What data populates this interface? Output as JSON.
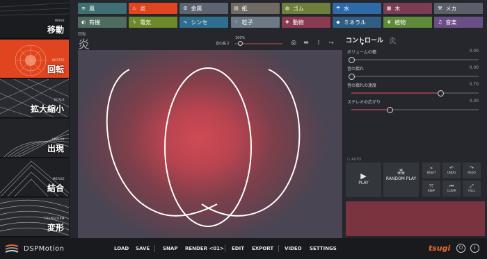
{
  "modes": [
    {
      "en": "MOVE",
      "jp": "移動",
      "active": false
    },
    {
      "en": "ROTATE",
      "jp": "回転",
      "active": true
    },
    {
      "en": "SCALE",
      "jp": "拡大縮小",
      "active": false
    },
    {
      "en": "APPEAR",
      "jp": "出現",
      "active": false
    },
    {
      "en": "MERGE",
      "jp": "結合",
      "active": false
    },
    {
      "en": "TRANSFORM",
      "jp": "変形",
      "active": false
    }
  ],
  "categories": [
    {
      "icon": "wind-icon",
      "glyph": "≋",
      "label": "風",
      "color": "#3f6f72"
    },
    {
      "icon": "flame-icon",
      "glyph": "♨",
      "label": "炎",
      "color": "#e0451f"
    },
    {
      "icon": "metal-icon",
      "glyph": "⚙",
      "label": "金属",
      "color": "#5b6470"
    },
    {
      "icon": "paper-icon",
      "glyph": "▤",
      "label": "紙",
      "color": "#6f6a64"
    },
    {
      "icon": "rubber-icon",
      "glyph": "◍",
      "label": "ゴム",
      "color": "#6d7f3a"
    },
    {
      "icon": "water-icon",
      "glyph": "☂",
      "label": "水",
      "color": "#2f6aa8"
    },
    {
      "icon": "wood-icon",
      "glyph": "▦",
      "label": "木",
      "color": "#7b3d52"
    },
    {
      "icon": "mecha-icon",
      "glyph": "⚒",
      "label": "メカ",
      "color": "#5a5f6a"
    },
    {
      "icon": "organic-icon",
      "glyph": "◐",
      "label": "有機",
      "color": "#4f6d5f"
    },
    {
      "icon": "electric-icon",
      "glyph": "ϟ",
      "label": "電気",
      "color": "#6d8a2a"
    },
    {
      "icon": "synth-icon",
      "glyph": "∿",
      "label": "シンセ",
      "color": "#2e6e8f"
    },
    {
      "icon": "particle-icon",
      "glyph": "⁘",
      "label": "粒子",
      "color": "#6b7a86"
    },
    {
      "icon": "animal-icon",
      "glyph": "❖",
      "label": "動物",
      "color": "#8a3b52"
    },
    {
      "icon": "mineral-icon",
      "glyph": "◆",
      "label": "ミネラル",
      "color": "#2f5d84"
    },
    {
      "icon": "plant-icon",
      "glyph": "❦",
      "label": "植物",
      "color": "#5e8a3a"
    },
    {
      "icon": "music-icon",
      "glyph": "♫",
      "label": "音楽",
      "color": "#6a4f86"
    }
  ],
  "panel": {
    "mode_small": "回転",
    "category_title": "炎",
    "length_label": "音の長さ",
    "length_pct": "100%",
    "length_value": 0.1
  },
  "controls": {
    "tab": "コントロール",
    "caret": "▼",
    "category": "炎",
    "params": [
      {
        "label": "ボリュームの幅",
        "value": "0.00",
        "level": 0.0
      },
      {
        "label": "音の揺れ",
        "value": "0.00",
        "level": 0.0
      },
      {
        "label": "音の揺れの速度",
        "value": "0.70",
        "level": 0.7
      },
      {
        "label": "ステレオの広がり",
        "value": "0.30",
        "level": 0.3
      }
    ],
    "auto": "☐ AUTO",
    "play": "PLAY",
    "random_play": "RANDOM PLAY",
    "buttons": [
      {
        "label": "RESET",
        "glyph": "«",
        "icon": "reset-icon"
      },
      {
        "label": "UNDO",
        "glyph": "↶",
        "icon": "undo-icon"
      },
      {
        "label": "REDO",
        "glyph": "↷",
        "icon": "redo-icon"
      },
      {
        "label": "KEEP",
        "glyph": "⤧",
        "icon": "keep-icon"
      },
      {
        "label": "CLEAR",
        "glyph": "⏮",
        "icon": "clear-icon"
      },
      {
        "label": "FULL",
        "glyph": "⤢",
        "icon": "full-icon"
      }
    ]
  },
  "bottom": {
    "app_name": "DSPMotion",
    "menu": [
      "LOAD",
      "SAVE",
      "SNAP",
      "RENDER <01>",
      "EDIT",
      "EXPORT",
      "VIDEO",
      "SETTINGS"
    ],
    "brand": "tsugi"
  }
}
